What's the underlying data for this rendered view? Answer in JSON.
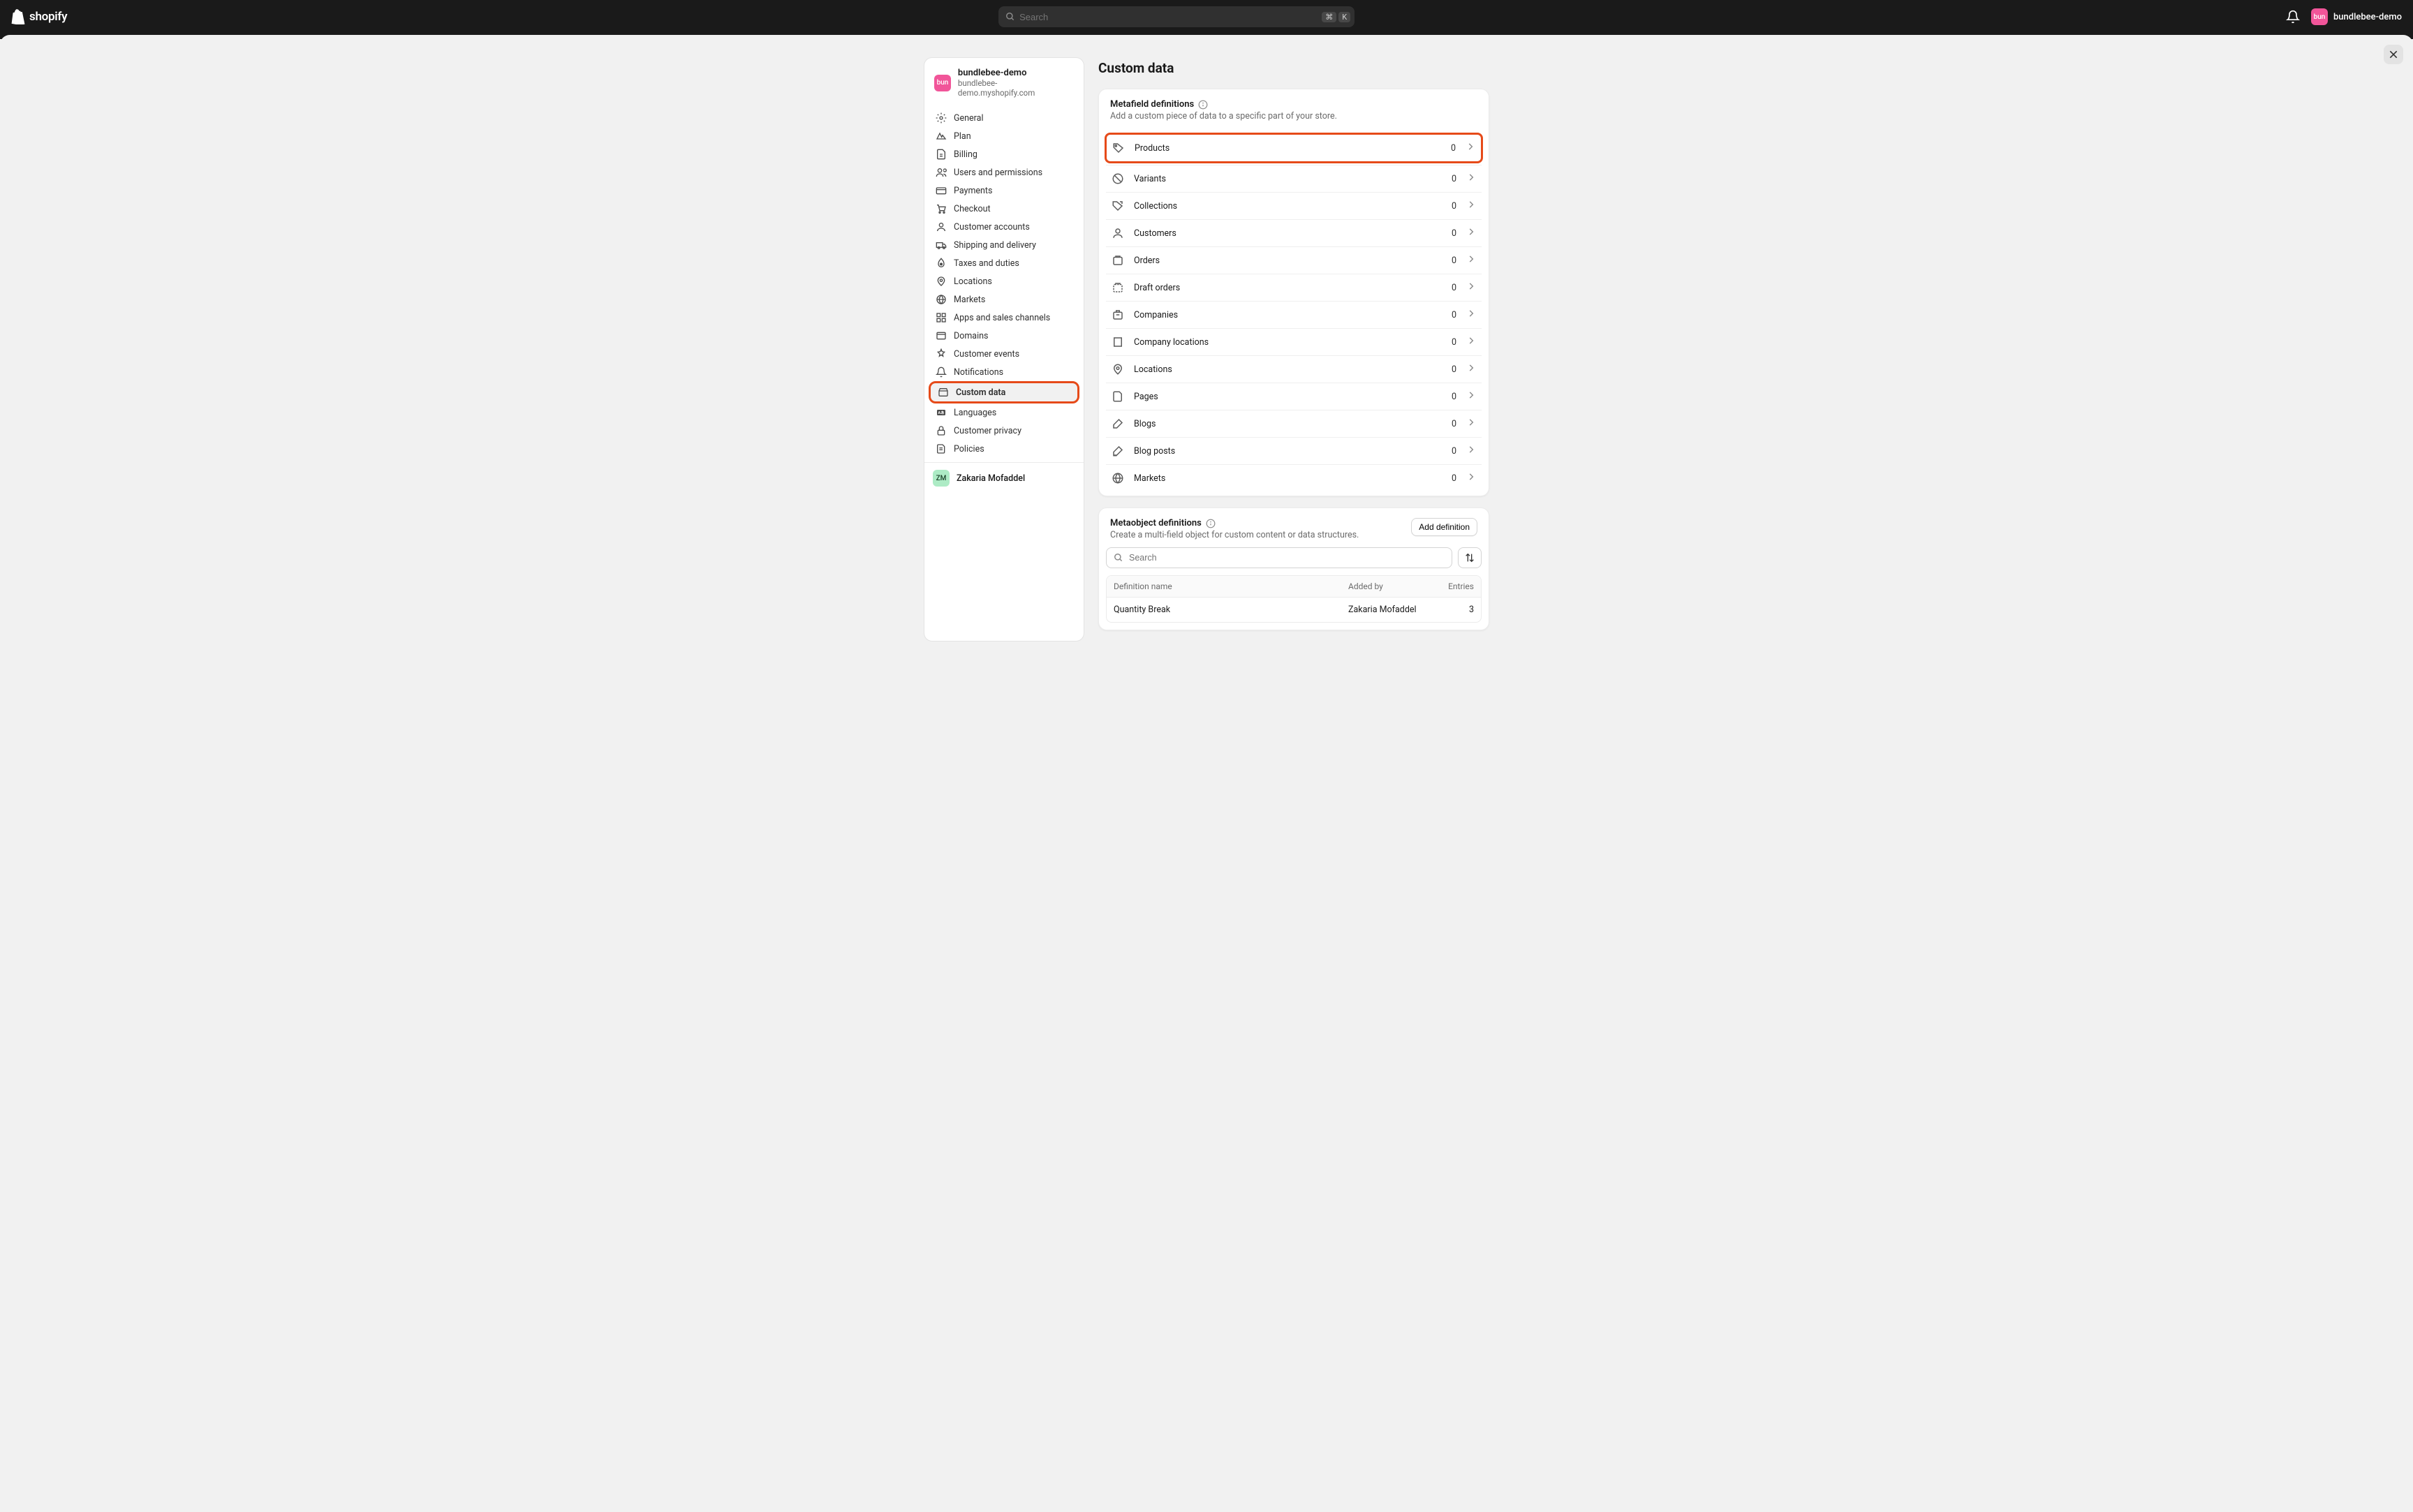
{
  "topbar": {
    "brand": "shopify",
    "search_placeholder": "Search",
    "shortcut_mod": "⌘",
    "shortcut_key": "K",
    "store_name": "bundlebee-demo",
    "store_avatar": "bun"
  },
  "sidebar": {
    "store_name": "bundlebee-demo",
    "store_domain": "bundlebee-demo.myshopify.com",
    "avatar": "bun",
    "items": [
      {
        "id": "general",
        "label": "General"
      },
      {
        "id": "plan",
        "label": "Plan"
      },
      {
        "id": "billing",
        "label": "Billing"
      },
      {
        "id": "users",
        "label": "Users and permissions"
      },
      {
        "id": "payments",
        "label": "Payments"
      },
      {
        "id": "checkout",
        "label": "Checkout"
      },
      {
        "id": "customer-accounts",
        "label": "Customer accounts"
      },
      {
        "id": "shipping",
        "label": "Shipping and delivery"
      },
      {
        "id": "taxes",
        "label": "Taxes and duties"
      },
      {
        "id": "locations",
        "label": "Locations"
      },
      {
        "id": "markets",
        "label": "Markets"
      },
      {
        "id": "apps",
        "label": "Apps and sales channels"
      },
      {
        "id": "domains",
        "label": "Domains"
      },
      {
        "id": "customer-events",
        "label": "Customer events"
      },
      {
        "id": "notifications",
        "label": "Notifications"
      },
      {
        "id": "custom-data",
        "label": "Custom data",
        "active": true,
        "highlight": true
      },
      {
        "id": "languages",
        "label": "Languages"
      },
      {
        "id": "customer-privacy",
        "label": "Customer privacy"
      },
      {
        "id": "policies",
        "label": "Policies"
      }
    ],
    "footer_user": "Zakaria Mofaddel",
    "footer_initials": "ZM"
  },
  "page": {
    "title": "Custom data",
    "metafield": {
      "title": "Metafield definitions",
      "desc": "Add a custom piece of data to a specific part of your store.",
      "rows": [
        {
          "label": "Products",
          "count": 0,
          "highlight": true
        },
        {
          "label": "Variants",
          "count": 0
        },
        {
          "label": "Collections",
          "count": 0
        },
        {
          "label": "Customers",
          "count": 0
        },
        {
          "label": "Orders",
          "count": 0
        },
        {
          "label": "Draft orders",
          "count": 0
        },
        {
          "label": "Companies",
          "count": 0
        },
        {
          "label": "Company locations",
          "count": 0
        },
        {
          "label": "Locations",
          "count": 0
        },
        {
          "label": "Pages",
          "count": 0
        },
        {
          "label": "Blogs",
          "count": 0
        },
        {
          "label": "Blog posts",
          "count": 0
        },
        {
          "label": "Markets",
          "count": 0
        }
      ]
    },
    "metaobject": {
      "title": "Metaobject definitions",
      "desc": "Create a multi-field object for custom content or data structures.",
      "add_button": "Add definition",
      "search_placeholder": "Search",
      "columns": {
        "name": "Definition name",
        "added_by": "Added by",
        "entries": "Entries"
      },
      "rows": [
        {
          "name": "Quantity Break",
          "added_by": "Zakaria Mofaddel",
          "entries": 3
        }
      ]
    }
  }
}
